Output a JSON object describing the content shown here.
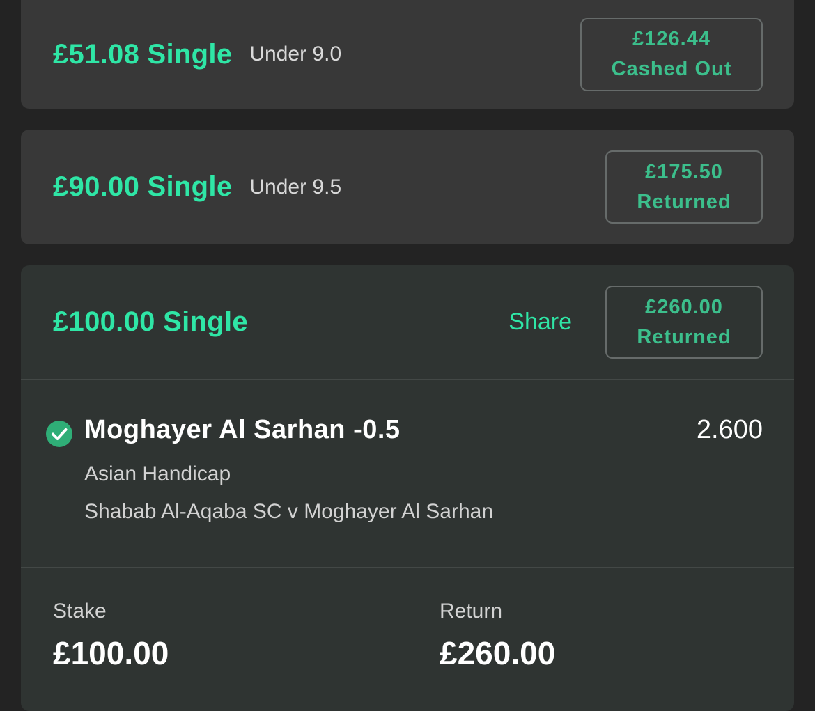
{
  "bets": [
    {
      "title": "£51.08 Single",
      "subtitle": "Under 9.0",
      "status_amount": "£126.44",
      "status_label": "Cashed Out"
    },
    {
      "title": "£90.00 Single",
      "subtitle": "Under 9.5",
      "status_amount": "£175.50",
      "status_label": "Returned"
    },
    {
      "title": "£100.00 Single",
      "share_label": "Share",
      "status_amount": "£260.00",
      "status_label": "Returned",
      "selection": {
        "name": "Moghayer Al Sarhan -0.5",
        "odds": "2.600",
        "market": "Asian Handicap",
        "event": "Shabab Al-Aqaba SC v Moghayer Al Sarhan",
        "result_icon": "check-circle-icon"
      },
      "stake_label": "Stake",
      "stake_value": "£100.00",
      "return_label": "Return",
      "return_value": "£260.00"
    }
  ],
  "colors": {
    "page_background": "#232323",
    "card_background": "#383838",
    "expanded_card_background": "#2f3432",
    "accent_green": "#2fe6a6",
    "status_green": "#3cbf8c",
    "check_green": "#2fae77"
  }
}
